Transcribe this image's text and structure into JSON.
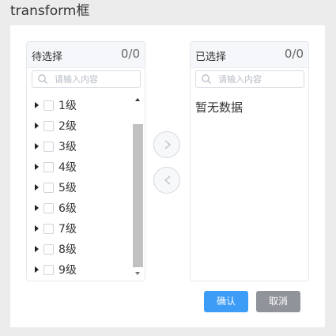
{
  "page": {
    "title": "transform框"
  },
  "source": {
    "title": "待选择",
    "count": "0/0",
    "search_placeholder": "请输入内容",
    "items": [
      {
        "label": "1级"
      },
      {
        "label": "2级"
      },
      {
        "label": "3级"
      },
      {
        "label": "4级"
      },
      {
        "label": "5级"
      },
      {
        "label": "6级"
      },
      {
        "label": "7级"
      },
      {
        "label": "8级"
      },
      {
        "label": "9级"
      }
    ]
  },
  "target": {
    "title": "已选择",
    "count": "0/0",
    "search_placeholder": "请输入内容",
    "empty_text": "暂无数据"
  },
  "actions": {
    "confirm_label": "确认",
    "cancel_label": "取消"
  },
  "colors": {
    "confirm": "#3d9cf6",
    "cancel": "#909399"
  },
  "icons": {
    "search": "search-icon",
    "move_right": "chevron-right-icon",
    "move_left": "chevron-left-icon"
  }
}
